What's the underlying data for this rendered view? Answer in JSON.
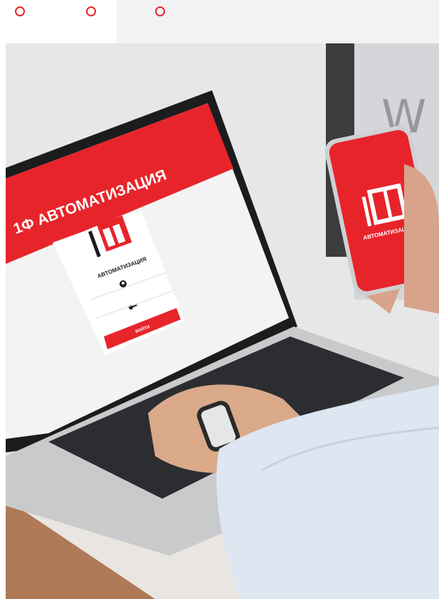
{
  "tabs": [
    {
      "id": "tab-1"
    },
    {
      "id": "tab-2"
    },
    {
      "id": "tab-3"
    }
  ],
  "colors": {
    "accent": "#e8242b",
    "tab_bar": "#f2f2f2",
    "laptop_screen_bg": "#f3f3f3",
    "laptop_body": "#c9cacc",
    "keyboard": "#2b2d30"
  },
  "laptop_screen": {
    "title": "1Ф АВТОМАТИЗАЦИЯ",
    "logo_caption": "АВТОМАТИЗАЦИЯ",
    "login_button_label": "ВОЙТИ",
    "user_icon": "user-icon",
    "key_icon": "key-icon"
  },
  "phone_screen": {
    "logo_caption": "АВТОМАТИЗАЦИЯ"
  },
  "background": {
    "wall_letters": "W"
  }
}
